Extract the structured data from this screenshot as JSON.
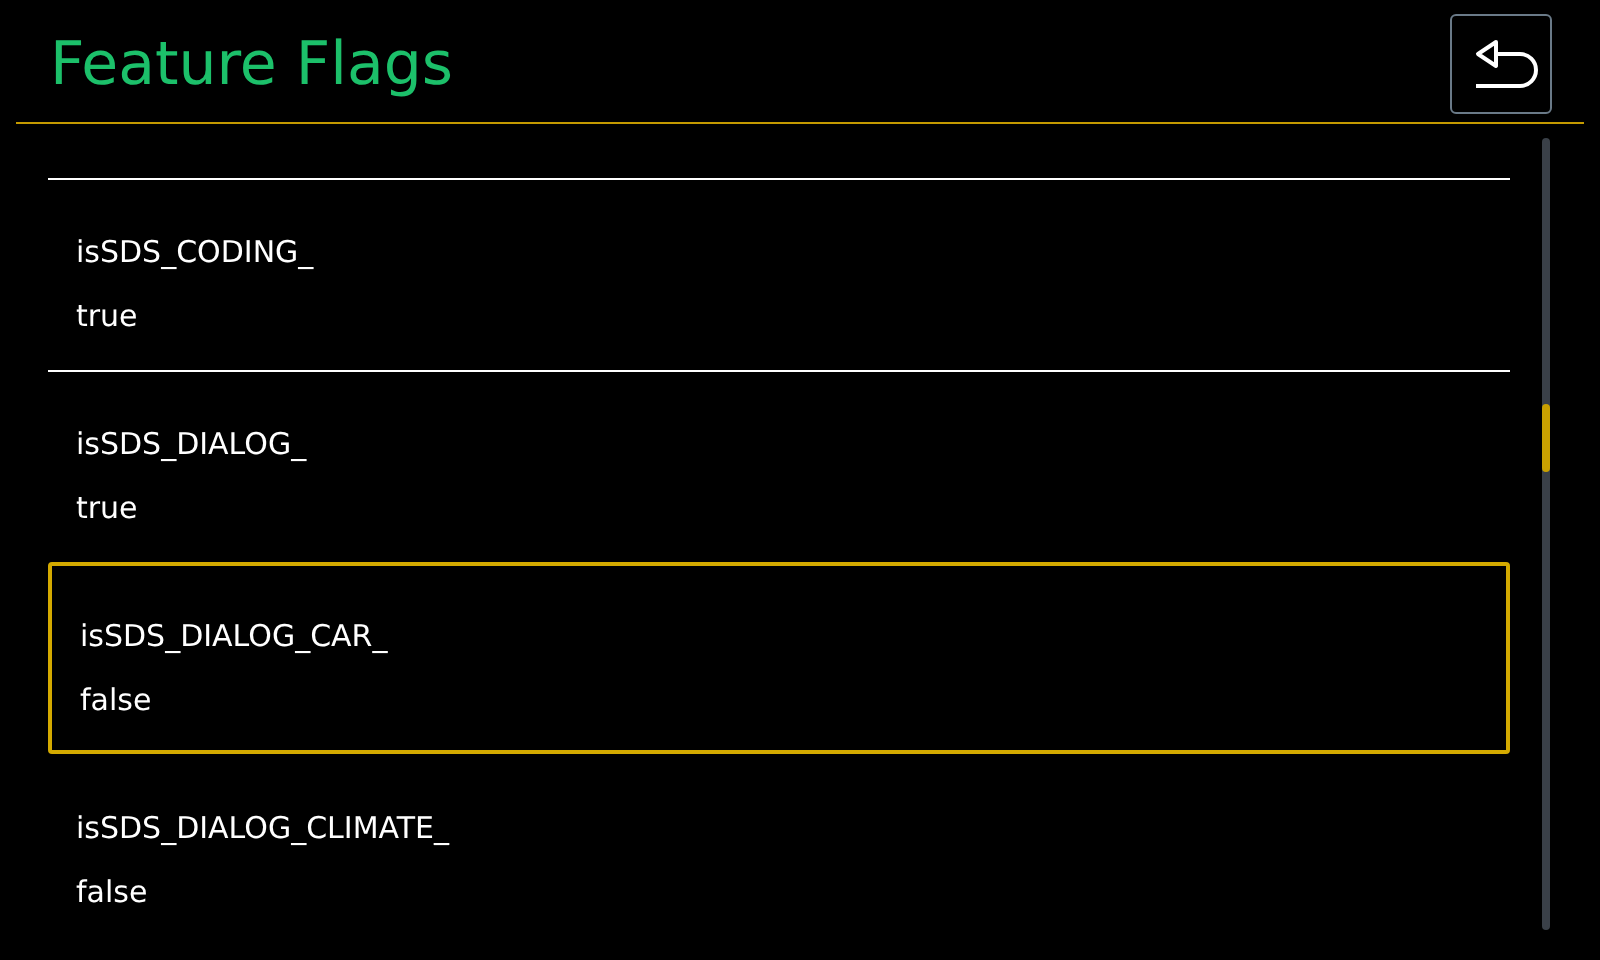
{
  "header": {
    "title": "Feature Flags"
  },
  "flags": [
    {
      "name": "isSDS_CODING_",
      "value": "true",
      "selected": false
    },
    {
      "name": "isSDS_DIALOG_",
      "value": "true",
      "selected": false
    },
    {
      "name": "isSDS_DIALOG_CAR_",
      "value": "false",
      "selected": true
    },
    {
      "name": "isSDS_DIALOG_CLIMATE_",
      "value": "false",
      "selected": false
    }
  ]
}
